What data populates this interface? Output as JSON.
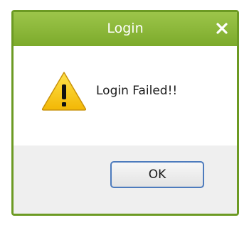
{
  "window": {
    "title": "Login",
    "title_bar_color": "#88b43a",
    "border_color": "#6c9a23"
  },
  "titlebar": {
    "close_icon": "close-icon"
  },
  "content": {
    "icon": "warning-icon",
    "message": "Login Failed!!"
  },
  "footer": {
    "ok_label": "OK",
    "button_border_color": "#4d7bbd"
  }
}
